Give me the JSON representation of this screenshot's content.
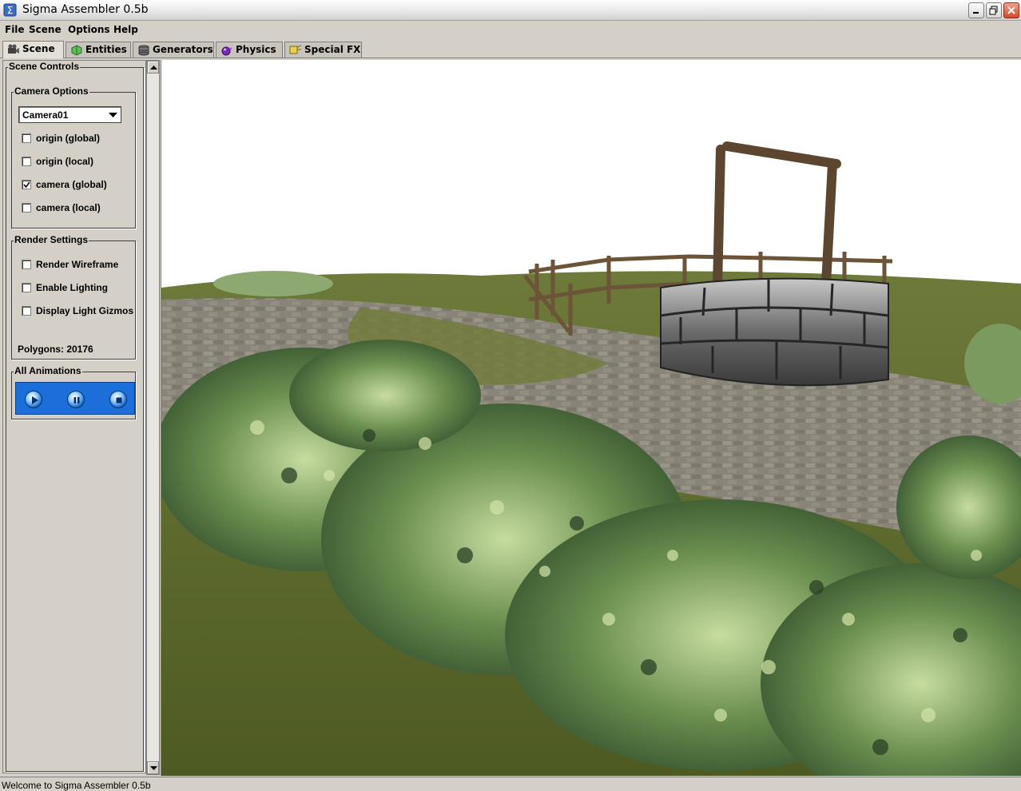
{
  "window": {
    "title": "Sigma Assembler 0.5b",
    "icon": "sigma-app-icon",
    "controls": [
      "minimize-icon",
      "maximize-icon",
      "close-icon"
    ]
  },
  "menu": {
    "items": [
      "File",
      "Scene",
      "Options",
      "Help"
    ]
  },
  "tabs": [
    {
      "label": "Scene",
      "icon": "camera-icon",
      "active": true
    },
    {
      "label": "Entities",
      "icon": "entity-icon",
      "active": false
    },
    {
      "label": "Generators",
      "icon": "generator-icon",
      "active": false
    },
    {
      "label": "Physics",
      "icon": "physics-icon",
      "active": false
    },
    {
      "label": "Special FX",
      "icon": "fx-icon",
      "active": false
    }
  ],
  "scene_controls": {
    "title": "Scene Controls",
    "camera_options": {
      "title": "Camera Options",
      "selected_camera": "Camera01",
      "checks": [
        {
          "label": "origin (global)",
          "checked": false
        },
        {
          "label": "origin (local)",
          "checked": false
        },
        {
          "label": "camera (global)",
          "checked": true
        },
        {
          "label": "camera (local)",
          "checked": false
        }
      ]
    },
    "render_settings": {
      "title": "Render Settings",
      "checks": [
        {
          "label": "Render Wireframe",
          "checked": false
        },
        {
          "label": "Enable Lighting",
          "checked": false
        },
        {
          "label": "Display Light Gizmos",
          "checked": false
        }
      ],
      "polygons": "Polygons: 20176"
    },
    "animations": {
      "title": "All Animations",
      "buttons": [
        "play-icon",
        "pause-icon",
        "stop-icon"
      ],
      "panel_color": "#1c6fd8"
    }
  },
  "status": {
    "text": "Welcome to Sigma Assembler 0.5b"
  }
}
